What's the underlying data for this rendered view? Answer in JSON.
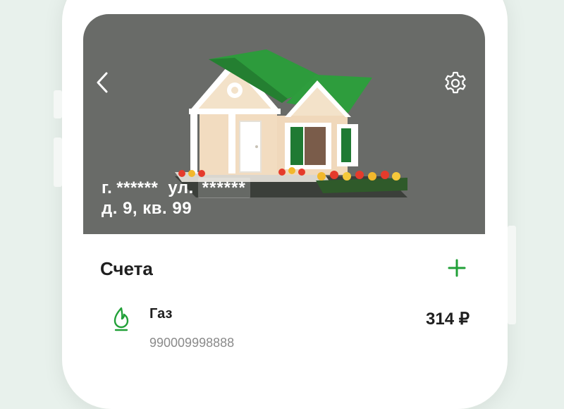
{
  "colors": {
    "background": "#e8f1ec",
    "hero_background": "#696b68",
    "accent_green": "#21a038",
    "text_primary": "#1f1f1f",
    "text_secondary": "#8a8a8a"
  },
  "header": {
    "back_icon": "chevron-left-icon",
    "settings_icon": "gear-icon"
  },
  "property": {
    "city_prefix": "г.",
    "city": "******",
    "street_prefix": "ул.",
    "street": "******",
    "line2": "д. 9, кв. 99",
    "image": "house-illustration"
  },
  "accounts": {
    "title": "Счета",
    "add_icon": "plus-icon",
    "items": [
      {
        "icon": "gas-flame-icon",
        "name": "Газ",
        "number": "990009998888",
        "amount": "314 ₽"
      }
    ]
  }
}
